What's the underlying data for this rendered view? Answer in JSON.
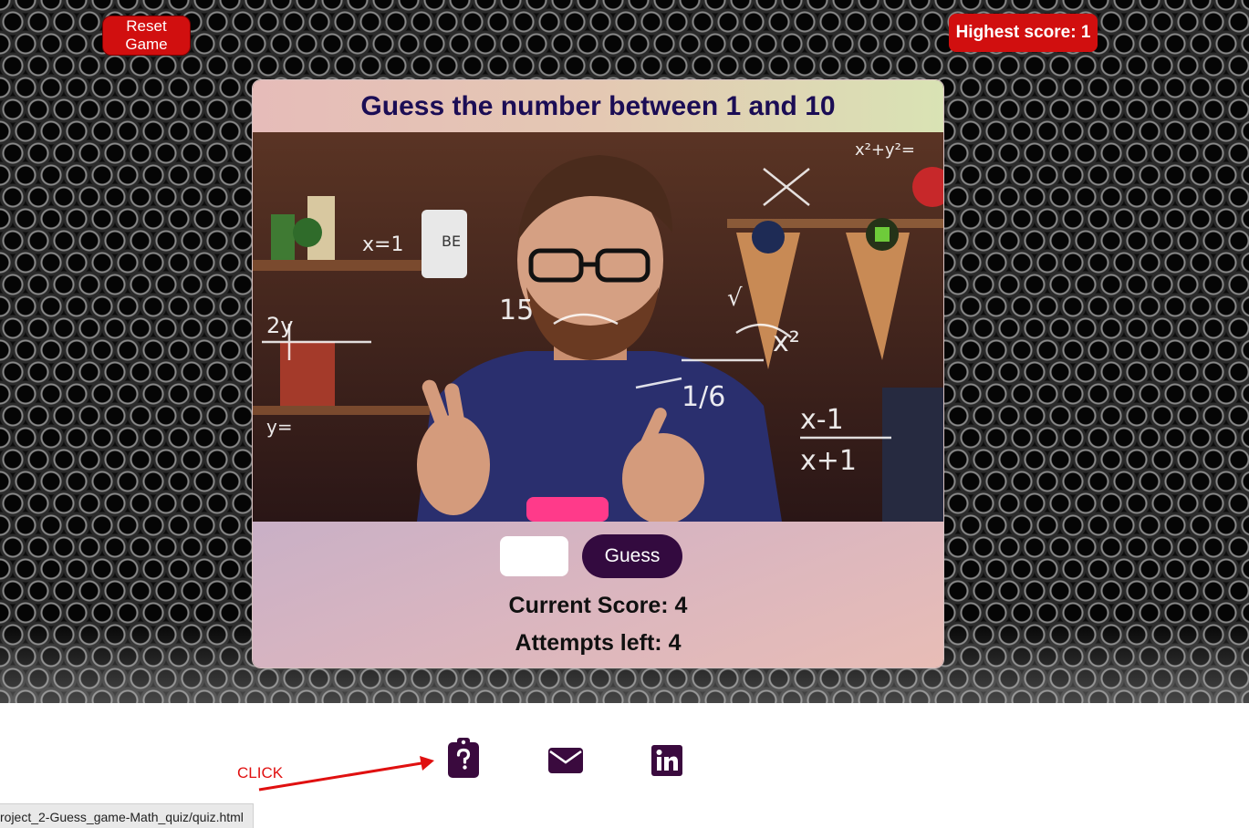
{
  "header": {
    "reset_label": "Reset\nGame",
    "highest_score_text": "Highest score: 1"
  },
  "game": {
    "title": "Guess the number between 1 and 10",
    "input_value": "",
    "guess_label": "Guess",
    "current_score_text": "Current Score: 4",
    "attempts_text": "Attempts left: 4"
  },
  "scene_chalk": [
    "x²+y²=",
    "2y",
    "x=1",
    "15",
    "x²",
    "x-1",
    "x+1",
    "1/6",
    "y=",
    "√",
    "BE"
  ],
  "footer": {
    "links": [
      {
        "icon": "quiz-clipboard-icon",
        "label": "quiz"
      },
      {
        "icon": "envelope-icon",
        "label": "email"
      },
      {
        "icon": "linkedin-icon",
        "label": "linkedin"
      }
    ],
    "click_annotation": "CLICK"
  },
  "status_bar": {
    "url": "roject_2-Guess_game-Math_quiz/quiz.html"
  },
  "colors": {
    "button_red": "#d10f0f",
    "title_navy": "#1b0d55",
    "guess_purple": "#330a3f",
    "icon_purple": "#3a0a3e",
    "annotation_red": "#e01010"
  }
}
